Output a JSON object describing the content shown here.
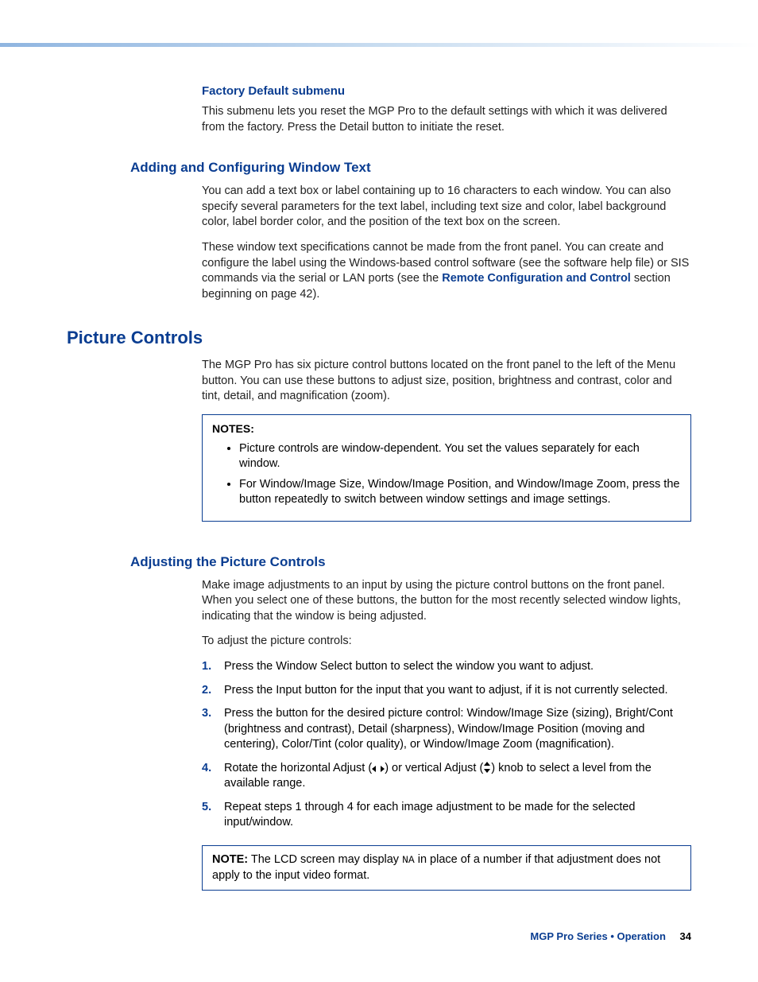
{
  "sections": {
    "factory": {
      "heading": "Factory Default submenu",
      "p1": "This submenu lets you reset the MGP Pro to the default settings with which it was delivered from the factory. Press the Detail button to initiate the reset."
    },
    "window_text": {
      "heading": "Adding and Configuring Window Text",
      "p1": "You can add a text box or label containing up to 16 characters to each window. You can also specify several parameters for the text label, including text size and color, label background color, label border color, and the position of the text box on the screen.",
      "p2a": "These window text specifications cannot be made from the front panel. You can create and configure the label using the Windows-based control software (see the software help file) or SIS commands via the serial or LAN ports (see the ",
      "linktext": "Remote Configuration and Control",
      "p2b": " section beginning on page 42)."
    },
    "picture_controls": {
      "heading": "Picture Controls",
      "p1": "The MGP Pro has six picture control buttons located on the front panel to the left of the Menu button. You can use these buttons to adjust size, position, brightness and contrast, color and tint, detail, and magnification (zoom).",
      "notes_label": "NOTES:",
      "notes": [
        "Picture controls are window-dependent. You set the values separately for each window.",
        "For Window/Image Size, Window/Image Position, and Window/Image Zoom, press the button repeatedly to switch between window settings and image settings."
      ]
    },
    "adjusting": {
      "heading": "Adjusting the Picture Controls",
      "p1": "Make image adjustments to an input by using the picture control buttons on the front panel. When you select one of these buttons, the button for the most recently selected window lights, indicating that the window is being adjusted.",
      "lead": "To adjust the picture controls:",
      "steps": [
        "Press the Window Select button to select the window you want to adjust.",
        "Press the Input button for the input that you want to adjust, if it is not currently selected.",
        "Press the button for the desired picture control: Window/Image Size (sizing), Bright/Cont (brightness and contrast), Detail (sharpness), Window/Image Position (moving and centering), Color/Tint (color quality), or Window/Image Zoom (magnification)."
      ],
      "step4a": "Rotate the horizontal Adjust (",
      "step4b": ") or vertical Adjust (",
      "step4c": ") knob to select a level from the available range.",
      "step5": "Repeat steps 1 through 4 for each image adjustment to be made for the selected input/window.",
      "note2_label": "NOTE:",
      "note2a": "The LCD screen may display ",
      "note2_na": "NA",
      "note2b": " in place of a number if that adjustment does not apply to the input video format."
    }
  },
  "footer": {
    "title": "MGP Pro Series • Operation",
    "page": "34"
  }
}
